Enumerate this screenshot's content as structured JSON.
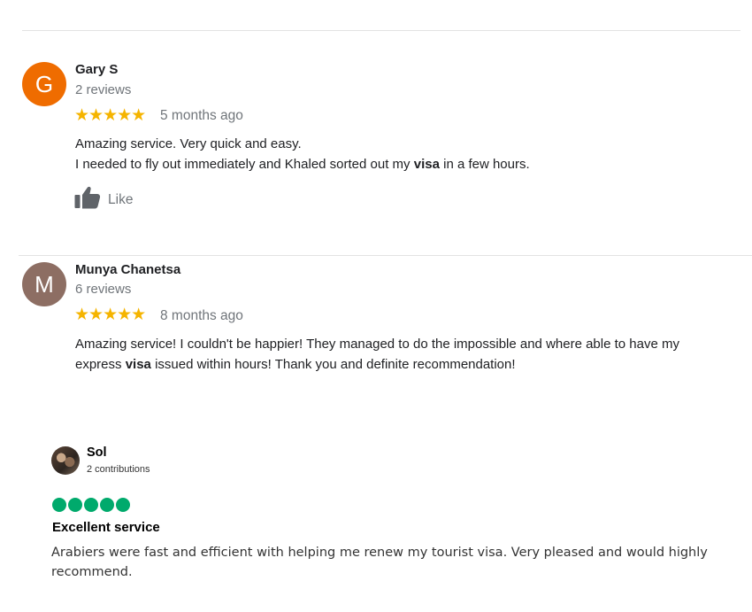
{
  "reviews": [
    {
      "avatar_letter": "G",
      "avatar_color": "#ef6c00",
      "name": "Gary S",
      "meta": "2 reviews",
      "stars": "★★★★★",
      "time": "5 months ago",
      "line1": "Amazing service. Very quick and easy.",
      "line2_before": "I needed to fly out immediately and Khaled sorted out my ",
      "line2_bold": "visa",
      "line2_after": " in a few hours.",
      "like_label": "Like"
    },
    {
      "avatar_letter": "M",
      "avatar_color": "#8d6e63",
      "name": "Munya Chanetsa",
      "meta": "6 reviews",
      "stars": "★★★★★",
      "time": "8 months ago",
      "line1": "Amazing service! I couldn't be happier! They managed to do the impossible and where able to have my",
      "line2_before": "express ",
      "line2_bold": "visa",
      "line2_after": " issued within hours! Thank you and definite recommendation!"
    }
  ],
  "tripadvisor": {
    "name": "Sol",
    "contributions": "2 contributions",
    "rating": 5,
    "bubble_color": "#00aa6c",
    "title": "Excellent service",
    "text_line1": "Arabiers were fast and efficient with helping me renew my tourist visa. Very pleased and would highly",
    "text_line2": "recommend."
  }
}
